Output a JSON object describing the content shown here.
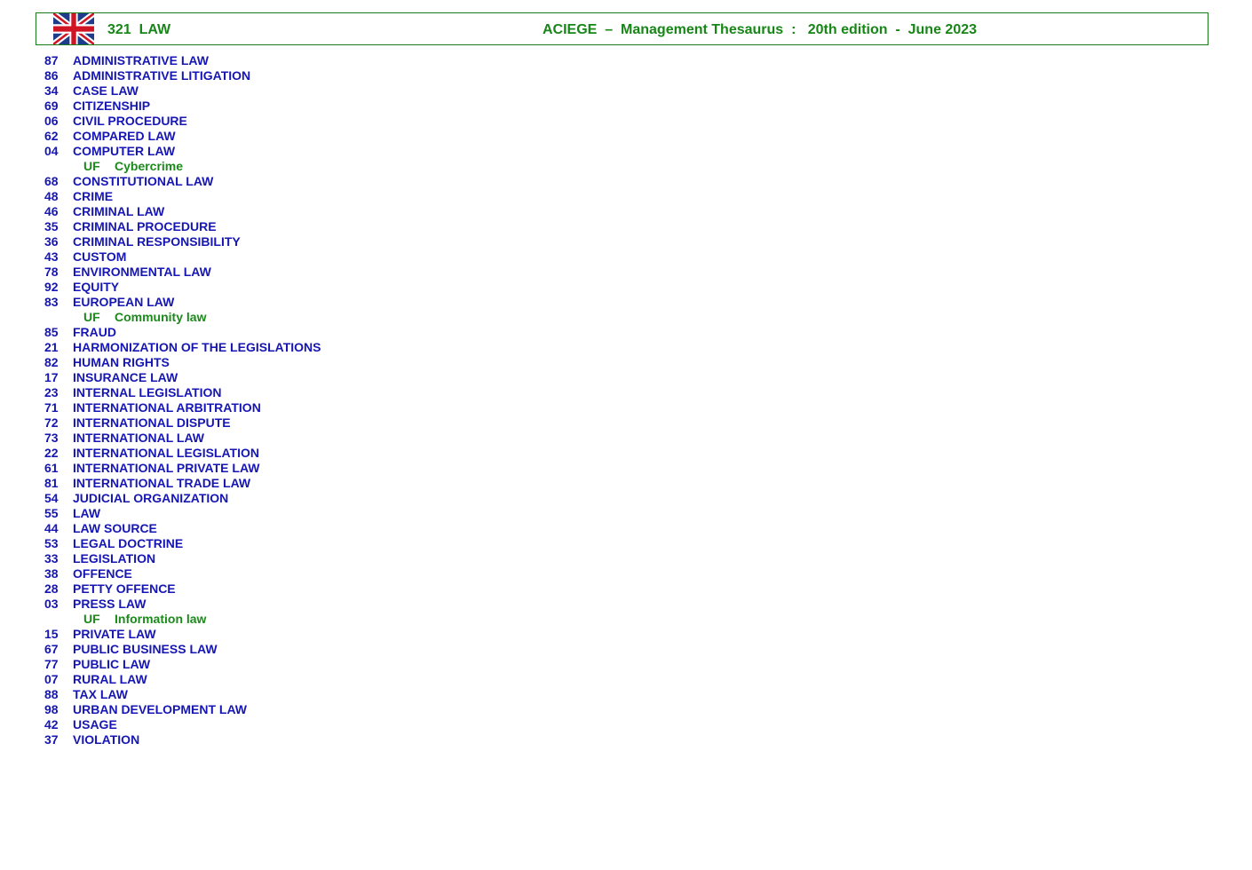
{
  "header": {
    "section": "321  LAW",
    "title": "ACIEGE  –  Management Thesaurus  :   20th edition  -  June 2023",
    "flag_icon": "uk-flag-icon"
  },
  "colors": {
    "border": "#1a7a1a",
    "header_text": "#178617",
    "term_text": "#1616b4",
    "uf_text": "#1b8a1b"
  },
  "entries": [
    {
      "code": "87",
      "term": "ADMINISTRATIVE LAW"
    },
    {
      "code": "86",
      "term": "ADMINISTRATIVE LITIGATION"
    },
    {
      "code": "34",
      "term": "CASE LAW"
    },
    {
      "code": "69",
      "term": "CITIZENSHIP"
    },
    {
      "code": "06",
      "term": "CIVIL PROCEDURE"
    },
    {
      "code": "62",
      "term": "COMPARED LAW"
    },
    {
      "code": "04",
      "term": "COMPUTER LAW"
    },
    {
      "uf": "UF",
      "term": "Cybercrime"
    },
    {
      "code": "68",
      "term": "CONSTITUTIONAL LAW"
    },
    {
      "code": "48",
      "term": "CRIME"
    },
    {
      "code": "46",
      "term": "CRIMINAL LAW"
    },
    {
      "code": "35",
      "term": "CRIMINAL PROCEDURE"
    },
    {
      "code": "36",
      "term": "CRIMINAL RESPONSIBILITY"
    },
    {
      "code": "43",
      "term": "CUSTOM"
    },
    {
      "code": "78",
      "term": "ENVIRONMENTAL LAW"
    },
    {
      "code": "92",
      "term": "EQUITY"
    },
    {
      "code": "83",
      "term": "EUROPEAN LAW"
    },
    {
      "uf": "UF",
      "term": "Community law"
    },
    {
      "code": "85",
      "term": "FRAUD"
    },
    {
      "code": "21",
      "term": "HARMONIZATION OF THE LEGISLATIONS"
    },
    {
      "code": "82",
      "term": "HUMAN RIGHTS"
    },
    {
      "code": "17",
      "term": "INSURANCE LAW"
    },
    {
      "code": "23",
      "term": "INTERNAL LEGISLATION"
    },
    {
      "code": "71",
      "term": "INTERNATIONAL ARBITRATION"
    },
    {
      "code": "72",
      "term": "INTERNATIONAL DISPUTE"
    },
    {
      "code": "73",
      "term": "INTERNATIONAL LAW"
    },
    {
      "code": "22",
      "term": "INTERNATIONAL LEGISLATION"
    },
    {
      "code": "61",
      "term": "INTERNATIONAL PRIVATE LAW"
    },
    {
      "code": "81",
      "term": "INTERNATIONAL TRADE LAW"
    },
    {
      "code": "54",
      "term": "JUDICIAL ORGANIZATION"
    },
    {
      "code": "55",
      "term": "LAW"
    },
    {
      "code": "44",
      "term": "LAW SOURCE"
    },
    {
      "code": "53",
      "term": "LEGAL DOCTRINE"
    },
    {
      "code": "33",
      "term": "LEGISLATION"
    },
    {
      "code": "38",
      "term": "OFFENCE"
    },
    {
      "code": "28",
      "term": "PETTY OFFENCE"
    },
    {
      "code": "03",
      "term": "PRESS LAW"
    },
    {
      "uf": "UF",
      "term": "Information law"
    },
    {
      "code": "15",
      "term": "PRIVATE LAW"
    },
    {
      "code": "67",
      "term": "PUBLIC BUSINESS LAW"
    },
    {
      "code": "77",
      "term": "PUBLIC LAW"
    },
    {
      "code": "07",
      "term": "RURAL LAW"
    },
    {
      "code": "88",
      "term": "TAX LAW"
    },
    {
      "code": "98",
      "term": "URBAN DEVELOPMENT LAW"
    },
    {
      "code": "42",
      "term": "USAGE"
    },
    {
      "code": "37",
      "term": "VIOLATION"
    }
  ]
}
